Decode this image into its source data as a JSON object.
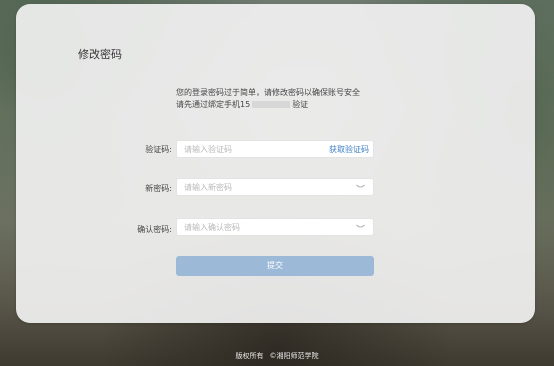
{
  "page": {
    "title": "修改密码"
  },
  "notice": {
    "line1": "您的登录密码过于简单，请修改密码以确保账号安全",
    "line2_prefix": "请先通过绑定手机15",
    "line2_suffix": "验证"
  },
  "form": {
    "code_label": "验证码:",
    "code_placeholder": "请输入验证码",
    "code_value": "",
    "get_code_label": "获取验证码",
    "new_password_label": "新密码:",
    "new_password_placeholder": "请输入新密码",
    "new_password_value": "",
    "confirm_password_label": "确认密码:",
    "confirm_password_placeholder": "请输入确认密码",
    "confirm_password_value": "",
    "submit_label": "提交"
  },
  "footer": {
    "copyright": "版权所有",
    "org": "©湘阳师范学院"
  },
  "colors": {
    "accent": "#3e7fc4",
    "submit_bg": "#9cbad8"
  },
  "icons": {
    "password_toggle": "eye-closed-icon"
  }
}
